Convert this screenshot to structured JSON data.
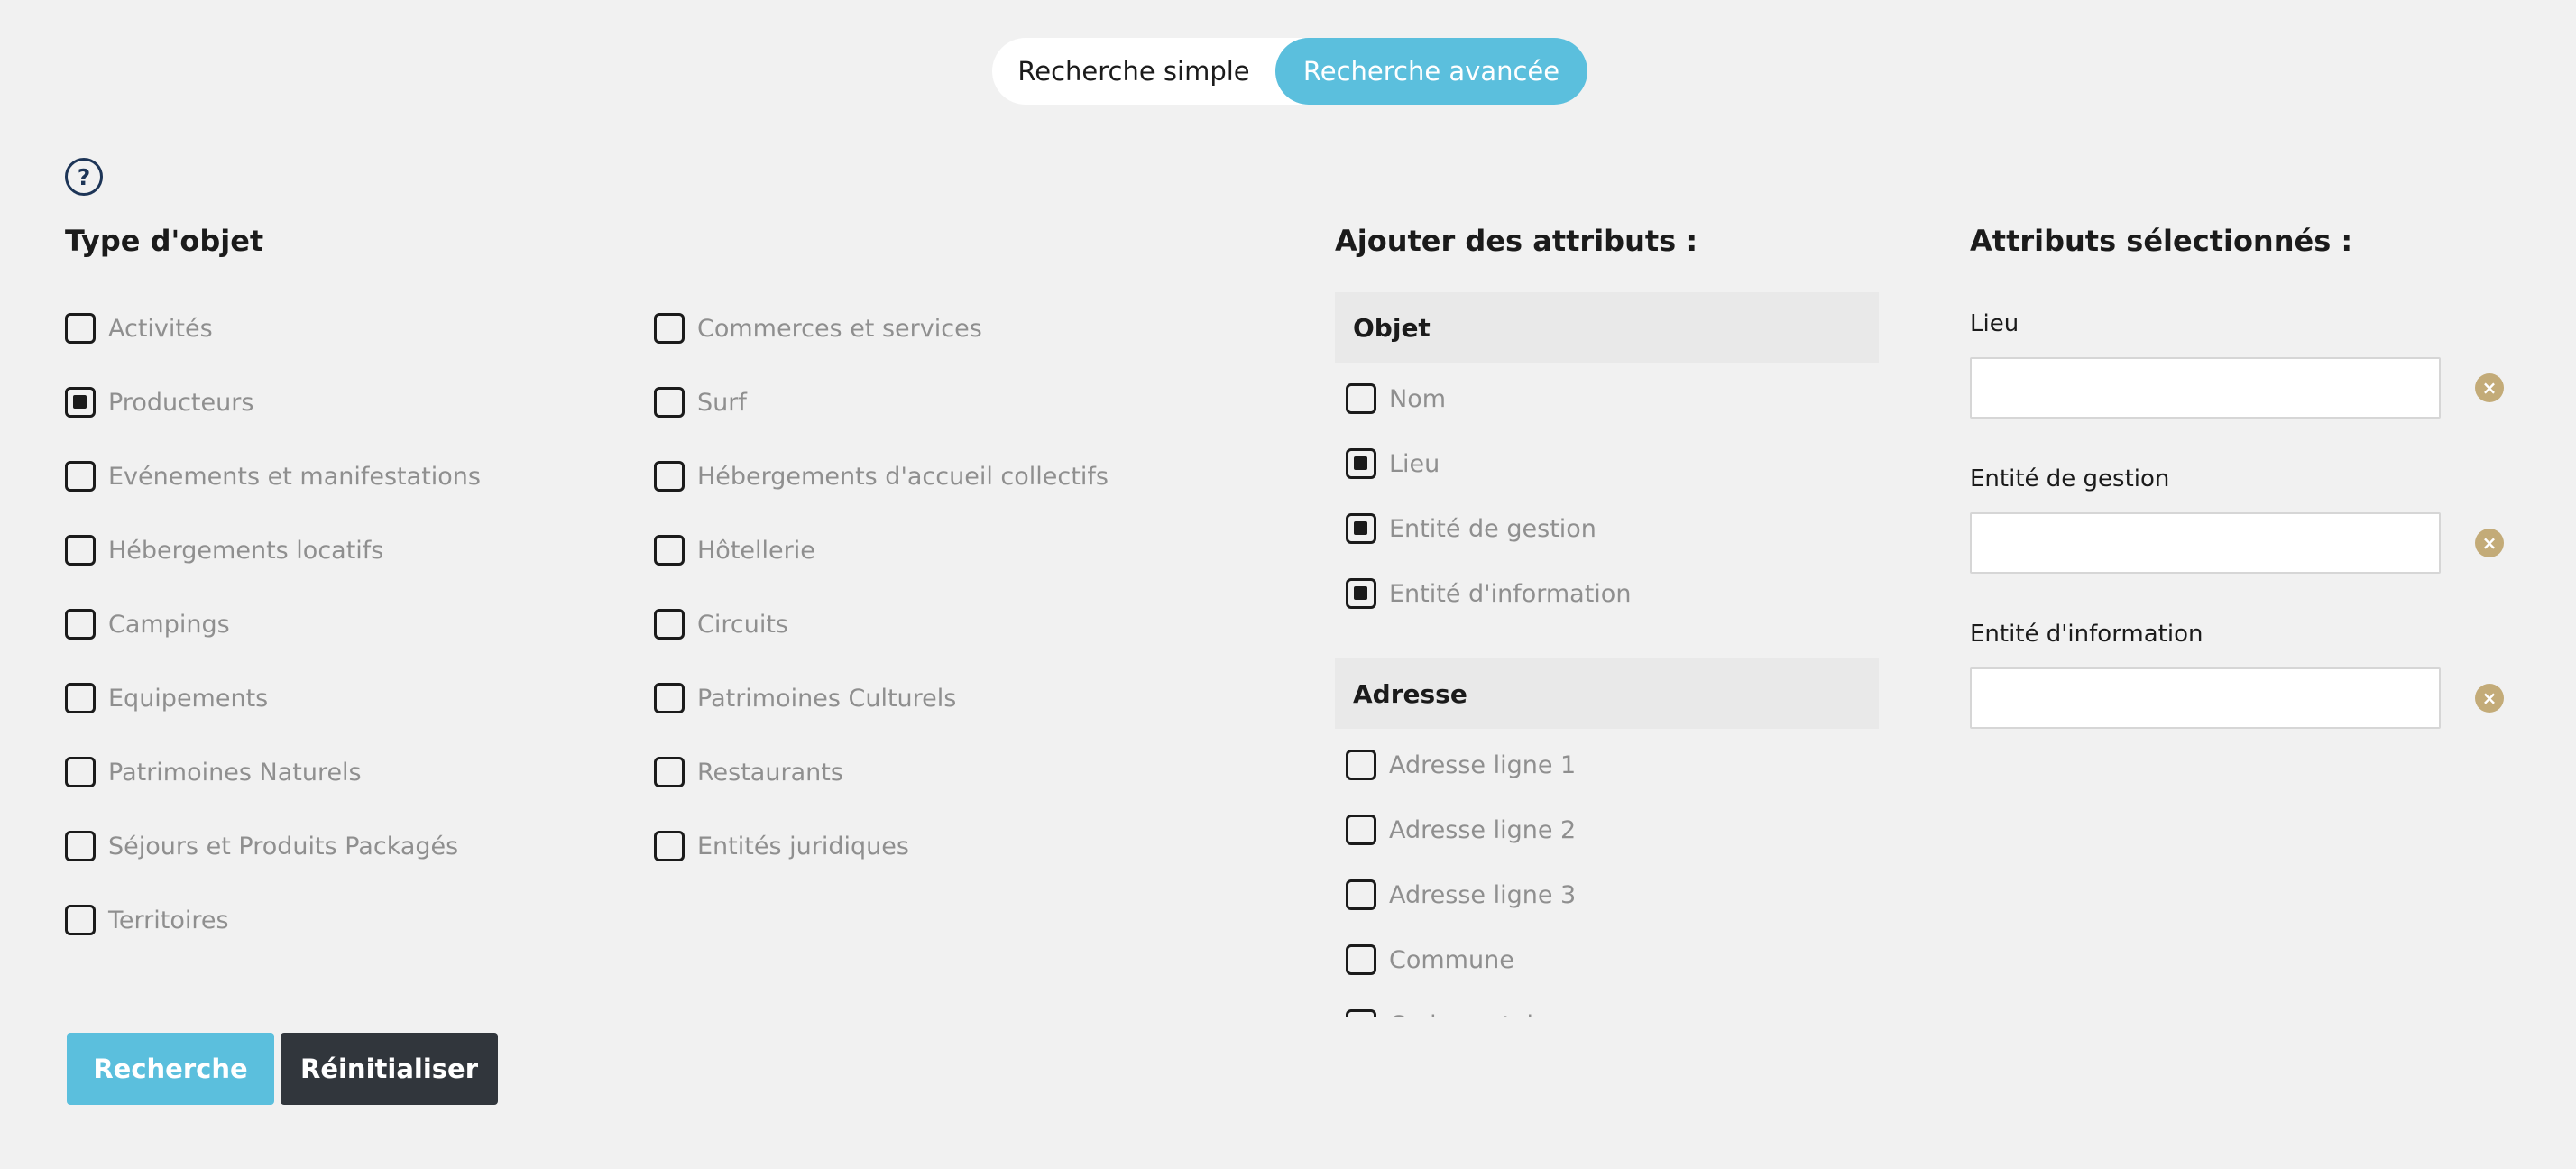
{
  "toggle": {
    "simple_label": "Recherche simple",
    "advanced_label": "Recherche avancée"
  },
  "help_icon_glyph": "?",
  "object_type": {
    "title": "Type d'objet",
    "col1": [
      {
        "label": "Activités",
        "checked": false
      },
      {
        "label": "Producteurs",
        "checked": true
      },
      {
        "label": "Evénements et manifestations",
        "checked": false
      },
      {
        "label": "Hébergements locatifs",
        "checked": false
      },
      {
        "label": "Campings",
        "checked": false
      },
      {
        "label": "Equipements",
        "checked": false
      },
      {
        "label": "Patrimoines Naturels",
        "checked": false
      },
      {
        "label": "Séjours et Produits Packagés",
        "checked": false
      },
      {
        "label": "Territoires",
        "checked": false
      }
    ],
    "col2": [
      {
        "label": "Commerces et services",
        "checked": false
      },
      {
        "label": "Surf",
        "checked": false
      },
      {
        "label": "Hébergements d'accueil collectifs",
        "checked": false
      },
      {
        "label": "Hôtellerie",
        "checked": false
      },
      {
        "label": "Circuits",
        "checked": false
      },
      {
        "label": "Patrimoines Culturels",
        "checked": false
      },
      {
        "label": "Restaurants",
        "checked": false
      },
      {
        "label": "Entités juridiques",
        "checked": false
      }
    ]
  },
  "add_attributes": {
    "title": "Ajouter des attributs :",
    "groups": [
      {
        "name": "Objet",
        "items": [
          {
            "label": "Nom",
            "checked": false
          },
          {
            "label": "Lieu",
            "checked": true
          },
          {
            "label": "Entité de gestion",
            "checked": true
          },
          {
            "label": "Entité d'information",
            "checked": true
          }
        ]
      },
      {
        "name": "Adresse",
        "items": [
          {
            "label": "Adresse ligne 1",
            "checked": false
          },
          {
            "label": "Adresse ligne 2",
            "checked": false
          },
          {
            "label": "Adresse ligne 3",
            "checked": false
          },
          {
            "label": "Commune",
            "checked": false
          },
          {
            "label": "Code postal",
            "checked": false
          }
        ]
      }
    ]
  },
  "selected_attributes": {
    "title": "Attributs sélectionnés :",
    "fields": [
      {
        "label": "Lieu",
        "value": ""
      },
      {
        "label": "Entité de gestion",
        "value": ""
      },
      {
        "label": "Entité d'information",
        "value": ""
      }
    ],
    "remove_glyph": "×"
  },
  "actions": {
    "search_label": "Recherche",
    "reset_label": "Réinitialiser"
  },
  "colors": {
    "accent": "#5bbfdd",
    "dark_button": "#31363c",
    "remove_badge": "#c3ab78",
    "background": "#f1f1f1"
  }
}
